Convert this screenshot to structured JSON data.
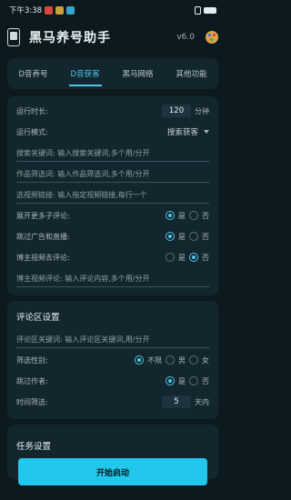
{
  "status_bar": {
    "time": "下午3:38"
  },
  "app": {
    "title": "黑马养号助手",
    "version": "v6.0"
  },
  "tabs": [
    {
      "label": "D音养号"
    },
    {
      "label": "D音获客"
    },
    {
      "label": "黑马网络"
    },
    {
      "label": "其他功能"
    }
  ],
  "run": {
    "duration_label": "运行时长:",
    "duration_value": "120",
    "duration_unit": "分钟",
    "mode_label": "运行模式:",
    "mode_value": "搜索获客",
    "search_kw_placeholder": "搜索关键词: 输入搜索关键词,多个用/分开",
    "works_filter_placeholder": "作品筛选词: 输入作品筛选词,多个用/分开",
    "video_link_placeholder": "选视频链接: 输入指定视频链接,每行一个",
    "expand_label": "展开更多子评论:",
    "skip_ads_label": "跳过广告和直播:",
    "blogger_dedupe_label": "博主视频去评论:",
    "blogger_comment_placeholder": "博主视频评论: 输入评论内容,多个用/分开",
    "yes": "是",
    "no": "否"
  },
  "comment": {
    "section_title": "评论区设置",
    "keyword_placeholder": "评论区关键词: 输入评论区关键词,用/分开",
    "gender_label": "筛选性别:",
    "gender_any": "不限",
    "gender_male": "男",
    "gender_female": "女",
    "skip_author_label": "跳过作者:",
    "yes": "是",
    "no": "否",
    "time_label": "时间筛选:",
    "time_value": "5",
    "time_unit": "天内"
  },
  "task": {
    "section_title": "任务设置"
  },
  "start_button": "开始启动"
}
